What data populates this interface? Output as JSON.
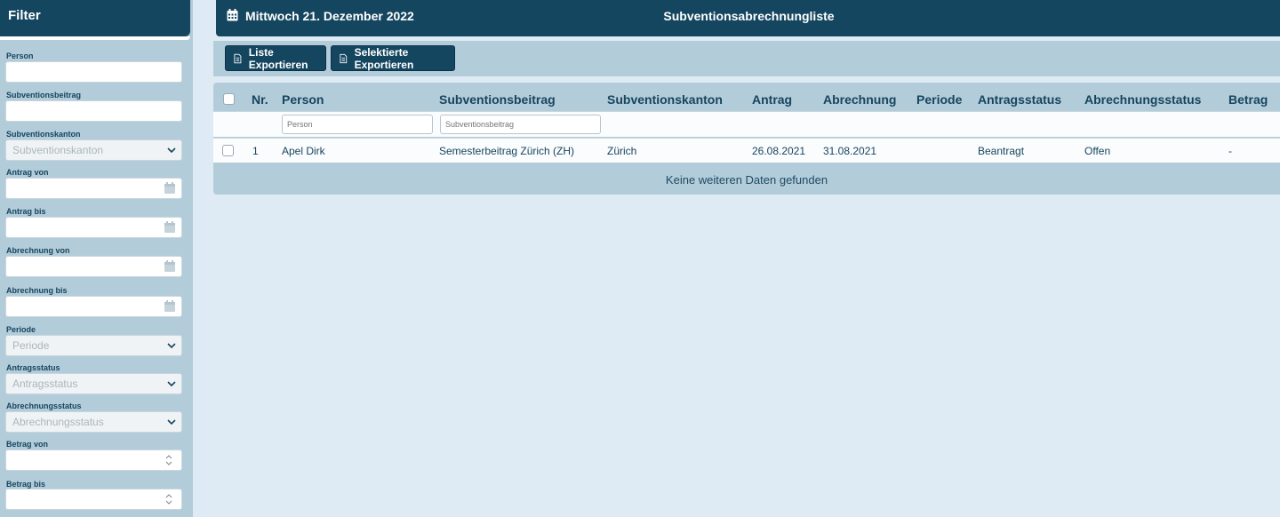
{
  "sidebar": {
    "title": "Filter",
    "fields": {
      "person": {
        "label": "Person",
        "value": ""
      },
      "beitrag": {
        "label": "Subventionsbeitrag",
        "value": ""
      },
      "kanton": {
        "label": "Subventionskanton",
        "selected": "Subventionskanton"
      },
      "antrag_von": {
        "label": "Antrag von"
      },
      "antrag_bis": {
        "label": "Antrag bis"
      },
      "abrechnung_von": {
        "label": "Abrechnung von"
      },
      "abrechnung_bis": {
        "label": "Abrechnung bis"
      },
      "periode": {
        "label": "Periode",
        "selected": "Periode"
      },
      "antragsstatus": {
        "label": "Antragsstatus",
        "selected": "Antragsstatus"
      },
      "abrechnungsstatus": {
        "label": "Abrechnungsstatus",
        "selected": "Abrechnungsstatus"
      },
      "betrag_von": {
        "label": "Betrag von"
      },
      "betrag_bis": {
        "label": "Betrag bis"
      }
    }
  },
  "header": {
    "date": "Mittwoch 21. Dezember 2022",
    "title": "Subventionsabrechnungliste"
  },
  "toolbar": {
    "export_list": "Liste Exportieren",
    "export_selected": "Selektierte Exportieren"
  },
  "table": {
    "columns": {
      "nr": "Nr.",
      "person": "Person",
      "beitrag": "Subventionsbeitrag",
      "kanton": "Subventionskanton",
      "antrag": "Antrag",
      "abrechnung": "Abrechnung",
      "periode": "Periode",
      "antragsstatus": "Antragsstatus",
      "abrechnungsstatus": "Abrechnungsstatus",
      "betrag": "Betrag"
    },
    "filters": {
      "person_placeholder": "Person",
      "beitrag_placeholder": "Subventionsbeitrag"
    },
    "rows": [
      {
        "nr": "1",
        "person": "Apel Dirk",
        "beitrag": "Semesterbeitrag Zürich (ZH)",
        "kanton": "Zürich",
        "antrag": "26.08.2021",
        "abrechnung": "31.08.2021",
        "periode": "",
        "antragsstatus": "Beantragt",
        "abrechnungsstatus": "Offen",
        "betrag": "-"
      }
    ],
    "empty_text": "Keine weiteren Daten gefunden"
  },
  "colors": {
    "primary": "#154660",
    "panel": "#b3ccda",
    "background": "#deebf4"
  }
}
